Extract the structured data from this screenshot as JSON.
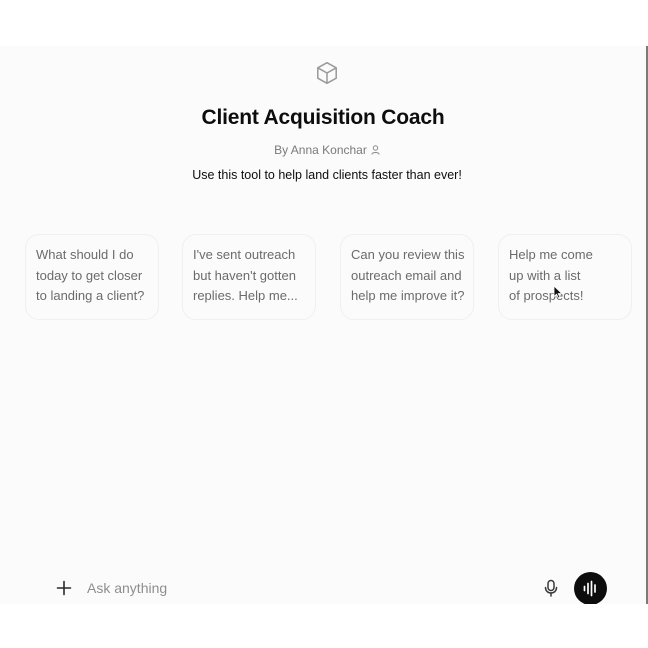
{
  "gpt": {
    "logo_icon": "gpt-cube-icon",
    "title": "Client Acquisition Coach",
    "byline": "By Anna Konchar",
    "byline_icon": "person-icon",
    "description": "Use this tool to help land clients faster than ever!"
  },
  "starters": [
    {
      "lines": [
        "What should I do",
        "today to get closer",
        "to landing a client?"
      ]
    },
    {
      "lines": [
        "I've sent outreach",
        "but haven't gotten",
        "replies. Help me..."
      ]
    },
    {
      "lines": [
        "Can you review this",
        "outreach email and",
        "help me improve it?"
      ]
    },
    {
      "lines": [
        "Help me come",
        "up with a list",
        "of prospects!"
      ]
    }
  ],
  "composer": {
    "placeholder": "Ask anything",
    "add_icon": "plus-icon",
    "mic_icon": "microphone-icon",
    "voice_icon": "voice-mode-icon"
  },
  "colors": {
    "accent": "#0d0d0d",
    "muted_text": "#6b6b6b",
    "background": "#fbfbfb"
  }
}
